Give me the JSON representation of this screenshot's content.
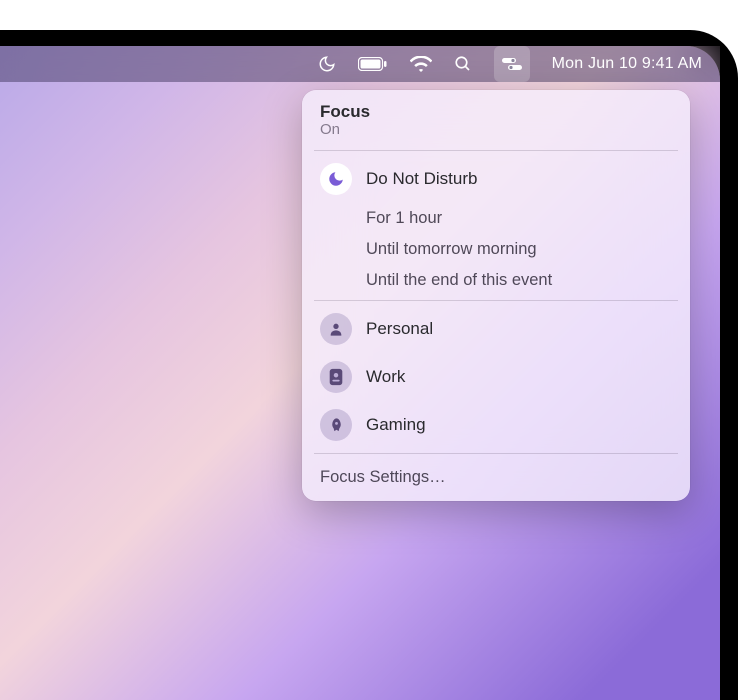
{
  "menubar": {
    "datetime": "Mon Jun 10  9:41 AM"
  },
  "popover": {
    "title": "Focus",
    "status": "On",
    "dnd_label": "Do Not Disturb",
    "durations": [
      "For 1 hour",
      "Until tomorrow morning",
      "Until the end of this event"
    ],
    "modes": [
      {
        "label": "Personal",
        "icon": "person"
      },
      {
        "label": "Work",
        "icon": "badge"
      },
      {
        "label": "Gaming",
        "icon": "rocket"
      }
    ],
    "settings_label": "Focus Settings…"
  },
  "colors": {
    "dnd_active_icon": "#7a5cd6"
  }
}
